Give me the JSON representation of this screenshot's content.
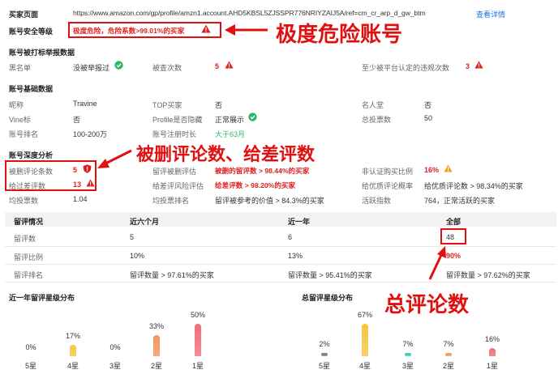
{
  "seller_page": {
    "label": "买家页面",
    "url": "https://www.amazon.com/gp/profile/amzn1.account.AHD5KBSL5ZJSSPR776NRIYZAIJ5A/ref=cm_cr_arp_d_gw_btm",
    "view_link": "查看详情"
  },
  "security": {
    "label": "账号安全等级",
    "value": "极度危险，危险系数>99.01%的买家"
  },
  "reported": {
    "section_title": "账号被打标举报数据",
    "blacklist_label": "黑名单",
    "blacklist_value": "没被举报过",
    "checked_label": "被查次数",
    "checked_value": "5",
    "platform_label": "至少被平台认定的违规次数",
    "platform_value": "3"
  },
  "basic": {
    "section_title": "账号基础数据",
    "rows": [
      [
        {
          "label": "昵称",
          "value": "Travine"
        },
        {
          "label": "TOP买家",
          "value": "否"
        },
        {
          "label": "名人堂",
          "value": "否"
        }
      ],
      [
        {
          "label": "Vine标",
          "value": "否"
        },
        {
          "label": "Profile是否隐藏",
          "value": "正常展示"
        },
        {
          "label": "总投票数",
          "value": "50"
        }
      ],
      [
        {
          "label": "账号排名",
          "value": "100-200万"
        },
        {
          "label": "账号注册时长",
          "value": "大于63月"
        },
        {
          "label": "",
          "value": ""
        }
      ]
    ]
  },
  "deep": {
    "section_title": "账号深度分析",
    "deleted_label": "被删评论条数",
    "deleted_value": "5",
    "deleted_rate_label": "留评被删评估",
    "deleted_rate_value": "被删的留评数 > 98.44%的买家",
    "non_verified_label": "非认证购买比例",
    "non_verified_value": "16%",
    "bad_label": "给过差评数",
    "bad_value": "13",
    "bad_risk_label": "给差评风险评估",
    "bad_risk_value": "给差评数 > 98.20%的买家",
    "good_prob_label": "给优质评论概率",
    "good_prob_value": "给优质评论数 > 98.34%的买家",
    "avg_votes_label": "均投票数",
    "avg_votes_value": "1.04",
    "avg_rank_label": "均投票排名",
    "avg_rank_value": "留评被参考的价值 > 84.3%的买家",
    "active_label": "活跃指数",
    "active_value": "764，正常活跃的买家"
  },
  "review_table": {
    "headers": [
      "留评情况",
      "近六个月",
      "近一年",
      "全部"
    ],
    "rows": [
      [
        "留评数",
        "5",
        "6",
        "48"
      ],
      [
        "留评比例",
        "10%",
        "13%",
        "90%"
      ],
      [
        "留评排名",
        "留评数量 > 97.61%的买家",
        "留评数量 > 95.41%的买家",
        "留评数量 > 97.62%的买家"
      ]
    ]
  },
  "annotations": {
    "danger_account": "极度危险账号",
    "deleted_and_bad": "被删评论数、给差评数",
    "total_reviews": "总评论数"
  },
  "chart_data": [
    {
      "type": "bar",
      "title": "近一年留评星级分布",
      "categories": [
        "5星",
        "4星",
        "3星",
        "2星",
        "1星"
      ],
      "values": [
        0,
        17,
        0,
        33,
        50
      ],
      "value_labels": [
        "0%",
        "17%",
        "0%",
        "33%",
        "50%"
      ],
      "colors": [
        "#d9d9d9",
        "#f5c542",
        "#d9d9d9",
        "#f5955a",
        "#f06f78"
      ],
      "ylim": [
        0,
        50
      ]
    },
    {
      "type": "bar",
      "title": "总留评星级分布",
      "categories": [
        "5星",
        "4星",
        "3星",
        "2星",
        "1星"
      ],
      "values": [
        2,
        67,
        7,
        7,
        16
      ],
      "value_labels": [
        "2%",
        "67%",
        "7%",
        "7%",
        "16%"
      ],
      "colors": [
        "#7a7a7a",
        "#f5c542",
        "#3fc7b5",
        "#f5955a",
        "#f06f78"
      ],
      "ylim": [
        0,
        67
      ]
    }
  ],
  "colors": {
    "accent_red": "#e01010",
    "danger_text": "#e02020",
    "ok_green": "#31b56a",
    "link_blue": "#1a73e8",
    "warn_orange": "#f08a00"
  }
}
